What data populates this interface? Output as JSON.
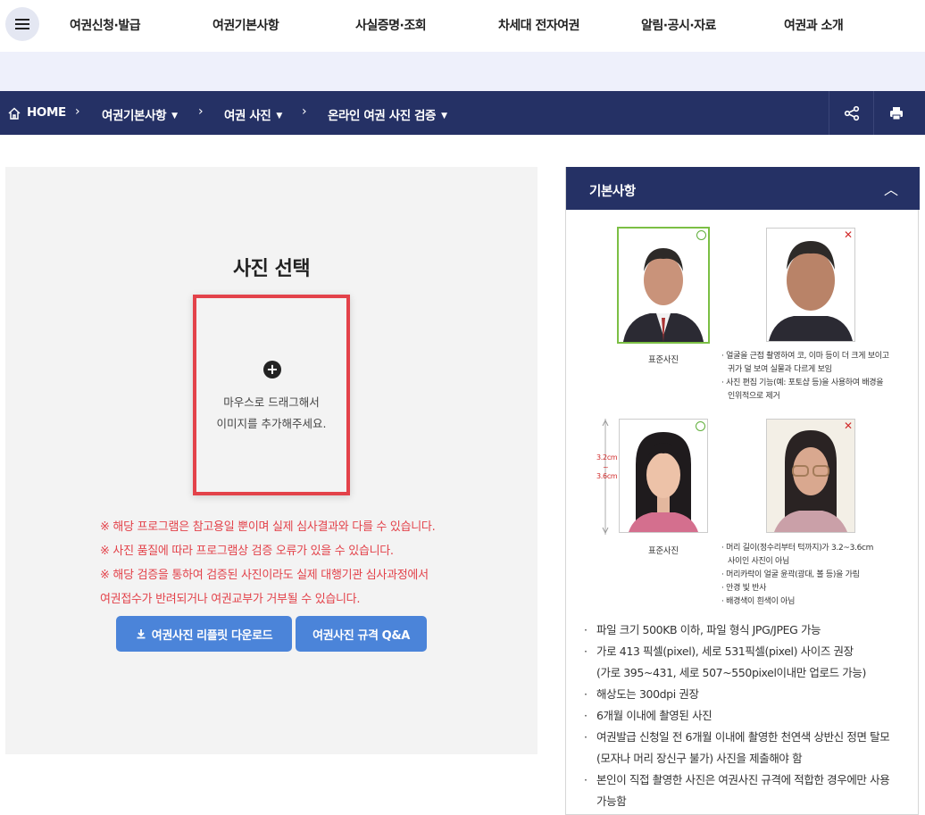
{
  "nav": {
    "items": [
      "여권신청·발급",
      "여권기본사항",
      "사실증명·조회",
      "차세대 전자여권",
      "알림·공시·자료",
      "여권과 소개"
    ]
  },
  "breadcrumb": {
    "home": "HOME",
    "level1": "여권기본사항",
    "level2": "여권 사진",
    "level3": "온라인 여권 사진 검증"
  },
  "upload": {
    "title": "사진 선택",
    "drop_line1": "마우스로 드래그해서",
    "drop_line2": "이미지를 추가해주세요.",
    "notices": [
      "※ 해당 프로그램은 참고용일 뿐이며 실제 심사결과와 다를 수 있습니다.",
      "※ 사진 품질에 따라 프로그램상 검증 오류가 있을 수 있습니다.",
      "※ 해당 검증을 통하여 검증된 사진이라도 실제 대행기관 심사과정에서",
      "여권접수가 반려되거나 여권교부가 거부될 수 있습니다."
    ],
    "download_button": "여권사진 리플릿 다운로드",
    "qa_button": "여권사진 규격 Q&A"
  },
  "basics": {
    "title": "기본사항",
    "standard_caption": "표준사진",
    "bad1_notes": [
      "· 얼굴을 근접 촬영하여 코, 이마 등이 더 크게 보이고",
      "귀가 덜 보여 실물과 다르게 보임",
      "· 사진 편집 기능(예: 포토샵 등)을 사용하여 배경을",
      "인위적으로 제거"
    ],
    "measure_top": "3.2cm",
    "measure_tilde": "~",
    "measure_bottom": "3.6cm",
    "bad2_notes": [
      "· 머리 길이(정수리부터 턱까지)가 3.2~3.6cm",
      "사이인 사진이 아님",
      "· 머리카락이 얼굴 윤곽(광대, 볼 등)을 가림",
      "· 안경 빛 반사",
      "· 배경색이 흰색이 아님"
    ],
    "rules": [
      "파일 크기 500KB 이하, 파일 형식 JPG/JPEG 가능",
      "가로 413 픽셀(pixel), 세로 531픽셀(pixel) 사이즈 권장",
      "(가로 395~431, 세로 507~550pixel이내만 업로드 가능)",
      "해상도는 300dpi 권장",
      "6개월 이내에 촬영된 사진",
      "여권발급 신청일 전 6개월 이내에 촬영한 천연색 상반신 정면 탈모",
      "(모자나 머리 장신구 불가) 사진을 제출해야 함",
      "본인이 직접 촬영한 사진은 여권사진 규격에 적합한 경우에만 사용",
      "가능함"
    ]
  },
  "colors": {
    "navy": "#253165",
    "band": "#eef0fb",
    "accent_red": "#e3424a",
    "button_blue": "#4b84d9",
    "ok_green": "#7bbf44"
  },
  "icons": [
    "menu-icon",
    "home-icon",
    "share-icon",
    "print-icon",
    "plus-icon",
    "download-icon",
    "chevron-up-icon"
  ]
}
